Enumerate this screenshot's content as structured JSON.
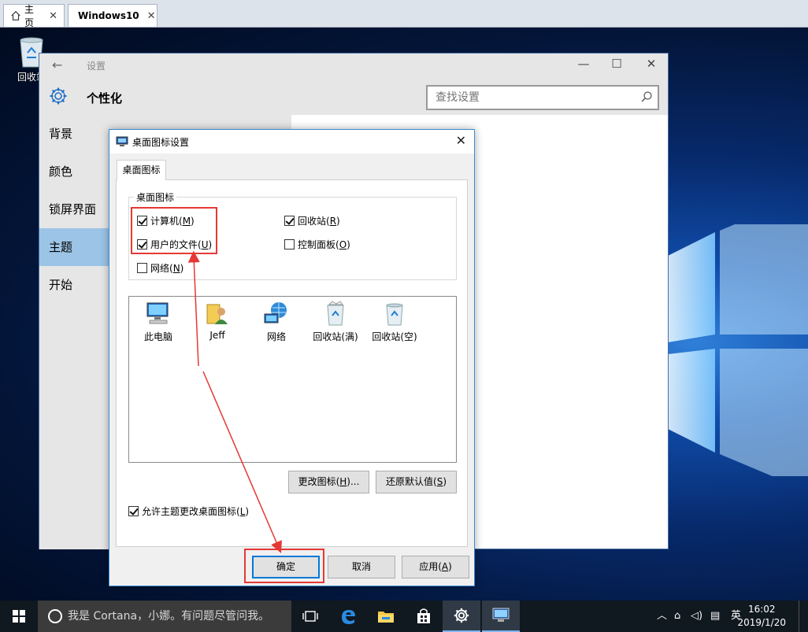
{
  "vm_tabs": {
    "home_label": "主页",
    "vm_label": "Windows10"
  },
  "desktop": {
    "recycle_bin_label": "回收站"
  },
  "settings": {
    "title": "设置",
    "category": "个性化",
    "search_placeholder": "查找设置",
    "nav_items": [
      "背景",
      "颜色",
      "锁屏界面",
      "主题",
      "开始"
    ],
    "active_index": 3
  },
  "dialog": {
    "title": "桌面图标设置",
    "tab": "桌面图标",
    "group_label": "桌面图标",
    "checkboxes": {
      "computer": {
        "label": "计算机(",
        "key": "M",
        "tail": ")",
        "checked": true
      },
      "recycle": {
        "label": "回收站(",
        "key": "R",
        "tail": ")",
        "checked": true
      },
      "user_files": {
        "label": "用户的文件(",
        "key": "U",
        "tail": ")",
        "checked": true
      },
      "control_panel": {
        "label": "控制面板(",
        "key": "O",
        "tail": ")",
        "checked": false
      },
      "network": {
        "label": "网络(",
        "key": "N",
        "tail": ")",
        "checked": false
      }
    },
    "icons": [
      "此电脑",
      "Jeff",
      "网络",
      "回收站(满)",
      "回收站(空)"
    ],
    "change_icon_button": {
      "label": "更改图标(",
      "key": "H",
      "tail": ")..."
    },
    "restore_button": {
      "label": "还原默认值(",
      "key": "S",
      "tail": ")"
    },
    "allow_theme": {
      "label": "允许主题更改桌面图标(",
      "key": "L",
      "tail": ")",
      "checked": true
    },
    "ok_button": "确定",
    "cancel_button": "取消",
    "apply_button": {
      "label": "应用(",
      "key": "A",
      "tail": ")"
    }
  },
  "taskbar": {
    "search_text": "我是 Cortana，小娜。有问题尽管问我。",
    "ime_label": "英",
    "time": "16:02",
    "date": "2019/1/20"
  },
  "colors": {
    "accent": "#0078d7",
    "annotation": "#e53935",
    "nav_active": "#9cc4e6"
  }
}
